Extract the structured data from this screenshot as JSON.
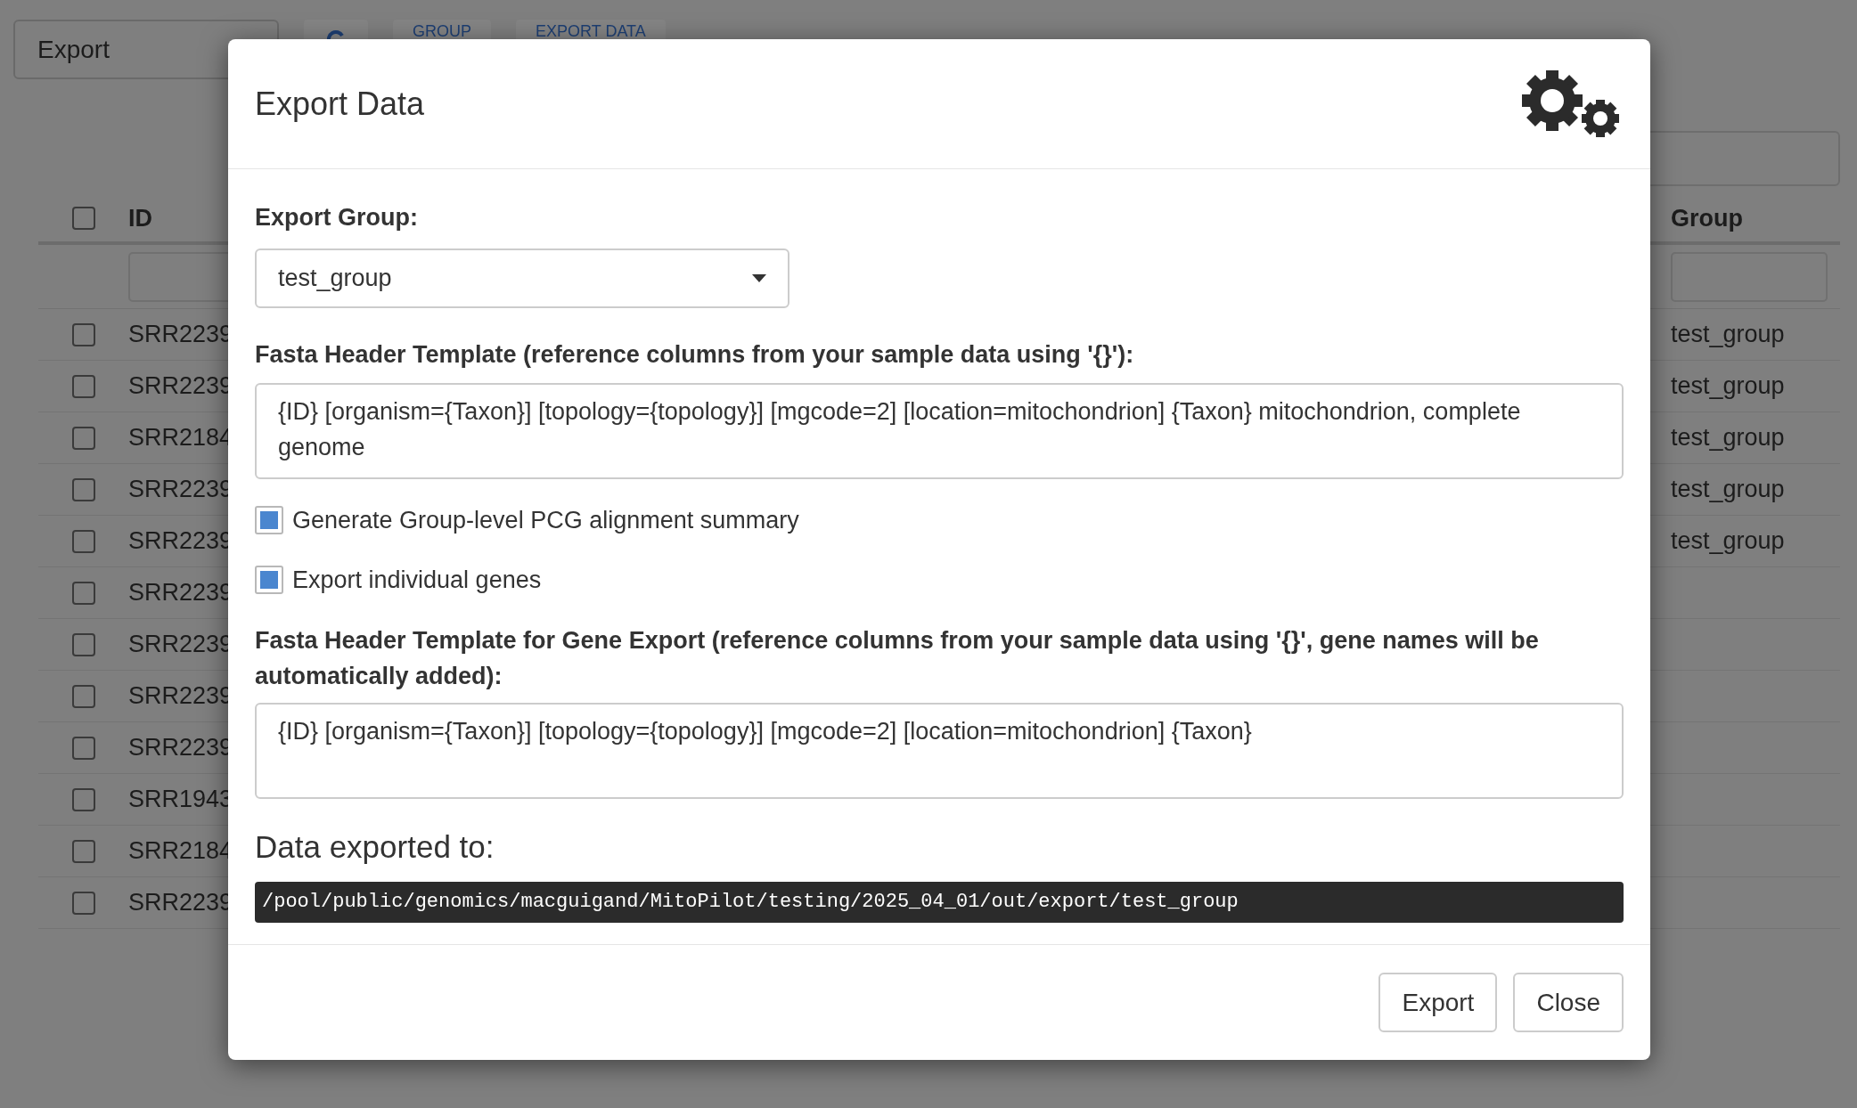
{
  "background": {
    "export_select": "Export",
    "buttons": [
      "GROUP",
      "EXPORT DATA"
    ],
    "table": {
      "header_checked": false,
      "columns": [
        "ID",
        "Group"
      ],
      "rows": [
        {
          "checked": false,
          "id": "SRR2239",
          "group": "test_group"
        },
        {
          "checked": false,
          "id": "SRR2239",
          "group": "test_group"
        },
        {
          "checked": false,
          "id": "SRR2184",
          "group": "test_group"
        },
        {
          "checked": false,
          "id": "SRR2239",
          "group": "test_group"
        },
        {
          "checked": false,
          "id": "SRR2239",
          "group": "test_group"
        },
        {
          "checked": false,
          "id": "SRR2239"
        },
        {
          "checked": false,
          "id": "SRR2239"
        },
        {
          "checked": false,
          "id": "SRR2239"
        },
        {
          "checked": false,
          "id": "SRR2239"
        },
        {
          "checked": false,
          "id": "SRR1943"
        },
        {
          "checked": false,
          "id": "SRR2184"
        },
        {
          "checked": false,
          "id": "SRR2239"
        }
      ]
    }
  },
  "modal": {
    "title": "Export Data",
    "export_group": {
      "label": "Export Group:",
      "value": "test_group"
    },
    "header_template": {
      "label": "Fasta Header Template (reference columns from your sample data using '{}'):",
      "value": "{ID} [organism={Taxon}] [topology={topology}] [mgcode=2] [location=mitochondrion] {Taxon} mitochondrion, complete genome"
    },
    "checkboxes": [
      {
        "label": "Generate Group-level PCG alignment summary",
        "checked": true
      },
      {
        "label": "Export individual genes",
        "checked": true
      }
    ],
    "gene_template": {
      "label": "Fasta Header Template for Gene Export (reference columns from your sample data using '{}', gene names will be automatically added):",
      "value": "{ID} [organism={Taxon}] [topology={topology}] [mgcode=2] [location=mitochondrion] {Taxon}"
    },
    "export_path": {
      "heading": "Data exported to:",
      "path": "/pool/public/genomics/macguigand/MitoPilot/testing/2025_04_01/out/export/test_group"
    },
    "buttons": [
      "Export",
      "Close"
    ]
  }
}
